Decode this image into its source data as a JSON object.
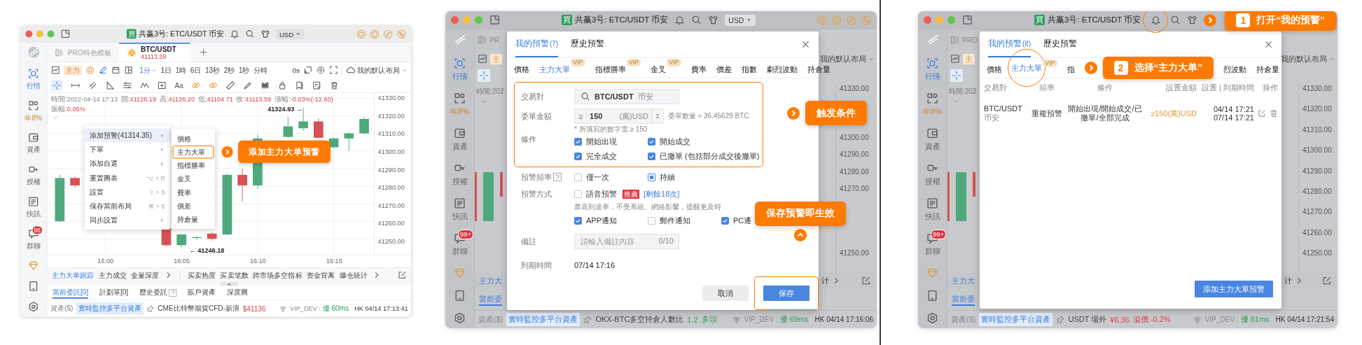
{
  "panels": [
    {
      "kind": "chart",
      "title_bar": {
        "badge": "買",
        "title": "共赢3号: ETC/USDT 币安",
        "bell_circled": false,
        "currency": "USD"
      },
      "sidebar": [
        {
          "kind": "market",
          "label": "行情",
          "selected": true
        },
        {
          "kind": "yield",
          "label": "年8%",
          "selected": false
        },
        {
          "kind": "assets",
          "label": "資產",
          "selected": false
        },
        {
          "kind": "auth",
          "label": "授權",
          "selected": false
        },
        {
          "kind": "news",
          "label": "快訊",
          "selected": false
        },
        {
          "kind": "chat",
          "label": "群聊",
          "selected": false,
          "badge": "96"
        }
      ],
      "tabs": [
        {
          "kind": "template",
          "label": "PRO特色模板",
          "selected": false
        },
        {
          "kind": "symbol",
          "label": "BTC/USDT",
          "price": "41113.59",
          "selected": true
        }
      ],
      "toolbar": {
        "badge": "主力",
        "intervals": [
          {
            "label": "1分",
            "selected": true
          },
          {
            "label": "1日",
            "selected": false
          },
          {
            "label": "1時",
            "selected": false
          },
          {
            "label": "6日",
            "selected": false
          },
          {
            "label": "13秒",
            "selected": false
          },
          {
            "label": "2秒",
            "selected": false
          },
          {
            "label": "1秒",
            "selected": false
          },
          {
            "label": "分時",
            "selected": false
          }
        ],
        "countdown": "0s",
        "layout": "我的默认布局"
      },
      "drawing_tools": {
        "text_tool": "Aa"
      },
      "chart": {
        "info": [
          {
            "kind": "time",
            "label": "時間:",
            "value": "2022-04-14 17:13"
          },
          {
            "kind": "price",
            "label": "開:",
            "value": "41126.19"
          },
          {
            "kind": "price",
            "label": "高:",
            "value": "41126.20"
          },
          {
            "kind": "price",
            "label": "低:",
            "value": "41104.71"
          },
          {
            "kind": "price",
            "label": "收:",
            "value": "41113.59"
          },
          {
            "kind": "price",
            "label": "漲幅:",
            "value": "-0.03%(-12.60)"
          },
          {
            "kind": "price",
            "label": "振幅:",
            "value": "0.05%"
          }
        ],
        "high_marker": "41324.93 →",
        "low_marker": "← 41246.18",
        "chart_data": {
          "type": "candlestick",
          "categories": [
            null,
            null,
            null,
            null,
            "16:00",
            null,
            null,
            null,
            null,
            "16:05",
            null,
            null,
            null,
            null,
            "16:10",
            null,
            null,
            null,
            null,
            "16:15",
            null,
            null
          ],
          "ohlc": [
            null,
            [
              41260.0,
              41286.4,
              41259.3,
              41284.6
            ],
            [
              41284.6,
              41285.4,
              41279.3,
              41280.4
            ],
            null,
            null,
            null,
            null,
            null,
            [
              41256.1,
              41256.1,
              41245.7,
              41246.4
            ],
            [
              41246.4,
              41252.5,
              41245.4,
              41252.5
            ],
            [
              41250.5,
              41251.5,
              41249.5,
              41251.0
            ],
            [
              41253.0,
              41253.5,
              41249.0,
              41250.0
            ],
            [
              41252.5,
              41287.1,
              41252.1,
              41286.4
            ],
            [
              41286.4,
              41290.0,
              41271.1,
              41280.4
            ],
            [
              41280.4,
              41309.3,
              41278.6,
              41307.1
            ],
            null,
            [
              41308.0,
              41319.3,
              41307.5,
              41314.0
            ],
            [
              41312.9,
              41324.6,
              41311.4,
              41316.8
            ],
            [
              41316.8,
              41318.6,
              41307.5,
              41307.5
            ],
            [
              41302.1,
              41307.8,
              41301.4,
              41307.1
            ],
            [
              41307.1,
              41310.7,
              41300.0,
              41310.0
            ],
            [
              41310.0,
              41319.3,
              41309.3,
              41318.2
            ]
          ],
          "grid": true,
          "ylim": [
            41241.1,
            41332.9
          ],
          "yticks": [
            {
              "value": 41330,
              "label": "41330.00"
            },
            {
              "value": 41320,
              "label": "41320.00"
            },
            {
              "value": 41310,
              "label": "41310.00"
            },
            {
              "value": 41300,
              "label": "41300.00"
            },
            {
              "value": 41290,
              "label": "41290.00"
            },
            {
              "value": 41280,
              "label": "41280.00"
            },
            {
              "value": 41270,
              "label": "41270.00"
            },
            {
              "value": 41260,
              "label": "41260.00"
            },
            {
              "value": 41250,
              "label": "41250.00"
            }
          ],
          "ylabel": null
        }
      },
      "context_menu": [
        {
          "label": "添加預警(41314.35)",
          "submenu": true,
          "selected": true
        },
        {
          "label": "下單",
          "submenu": true,
          "selected": false
        },
        {
          "label": "添加自選",
          "submenu": true,
          "selected": false
        },
        {
          "label": "重置圖表",
          "submenu": false,
          "selected": false,
          "shortcut": "⌥ + R"
        },
        {
          "label": "設置",
          "submenu": false,
          "selected": false,
          "shortcut": "⇧ + S"
        },
        {
          "label": "保存當前布局",
          "submenu": false,
          "selected": false,
          "shortcut": "⌘ + S"
        },
        {
          "label": "同步設置",
          "submenu": true,
          "selected": false
        }
      ],
      "submenu": [
        {
          "label": "價格",
          "highlighted": false
        },
        {
          "label": "主力大單",
          "highlighted": true
        },
        {
          "label": "指標勝率",
          "highlighted": false
        },
        {
          "label": "金叉",
          "highlighted": false
        },
        {
          "label": "費率",
          "highlighted": false
        },
        {
          "label": "價差",
          "highlighted": false
        },
        {
          "label": "持倉量",
          "highlighted": false
        }
      ],
      "callout": {
        "kind": "callout_right",
        "text": "添加主力大单预警"
      },
      "indicators": {
        "primary": [
          {
            "label": "主力大单跟踪",
            "selected": true
          },
          {
            "label": "主力成交",
            "selected": false
          },
          {
            "label": "全量深度",
            "selected": false
          }
        ],
        "secondary": [
          "买卖热度",
          "买卖笔数",
          "跨市场多空指标",
          "资金背离",
          "爆仓統计"
        ]
      },
      "bottom_tabs": [
        {
          "label": "當前委託[0]",
          "selected": true
        },
        {
          "label": "計劃單[0]",
          "selected": false
        },
        {
          "label": "歷史委託",
          "selected": false,
          "hint": "?"
        },
        {
          "label": "賬戶資產",
          "selected": false
        },
        {
          "label": "深度圖",
          "selected": false
        }
      ],
      "status_bar": {
        "assets": "資產($)",
        "monitor": "實時監控多平台資產",
        "ticker": [
          {
            "text": "CME比特幣期貨CFD-新浪",
            "color": "#444444"
          },
          {
            "text": "$41136",
            "color": "#d9434a"
          }
        ],
        "server": "VIP_DEV :",
        "latency": "優 60ms",
        "clock": "HK 04/14 17:13:41"
      }
    },
    {
      "kind": "alert_form",
      "title_bar": {
        "badge": "買",
        "title": "共赢3号: ETC/USDT 币安",
        "bell_circled": false,
        "currency": "USD"
      },
      "sidebar": [
        {
          "kind": "market",
          "label": "行情",
          "selected": true
        },
        {
          "kind": "yield",
          "label": "年8%",
          "selected": false
        },
        {
          "kind": "assets",
          "label": "資產",
          "selected": false
        },
        {
          "kind": "auth",
          "label": "授權",
          "selected": false
        },
        {
          "kind": "news",
          "label": "快訊",
          "selected": false
        },
        {
          "kind": "chat",
          "label": "群聊",
          "selected": false,
          "badge": "99+"
        }
      ],
      "left_strip": {
        "tab": "PR",
        "badge": "主",
        "info": "時間:202",
        "indicator": {
          "label": "主力大",
          "selected": true
        },
        "order_tab": {
          "label": "當前委",
          "selected": true
        }
      },
      "right_strip": {
        "layout": "我的默认布局",
        "items": [
          {
            "kind": "tick",
            "label": "41330.00"
          },
          {
            "kind": "callout_right",
            "text": "触发条件"
          },
          {
            "kind": "tick",
            "label": "41300.00"
          },
          {
            "kind": "tick",
            "label": "41290.00"
          },
          {
            "kind": "tick",
            "label": "41280.00"
          },
          {
            "kind": "tick",
            "label": "41270.00"
          },
          {
            "kind": "callout_up",
            "text": "保存预警即生效"
          },
          {
            "kind": "tick",
            "label": "41250.00"
          }
        ],
        "indicator": "计"
      },
      "modal": {
        "tabs": [
          {
            "label": "我的預警",
            "count": "(7)",
            "selected": true
          },
          {
            "label": "歷史預警",
            "selected": false
          }
        ],
        "types": [
          {
            "kind": "tab",
            "label": "價格",
            "selected": false
          },
          {
            "kind": "tab",
            "label": "主力大單",
            "badge": "VIP",
            "selected": true
          },
          {
            "kind": "tab",
            "label": "指標勝率",
            "badge": "VIP",
            "selected": false
          },
          {
            "kind": "tab",
            "label": "金叉",
            "badge": "VIP",
            "selected": false
          },
          {
            "kind": "tab",
            "label": "費率",
            "selected": false
          },
          {
            "kind": "tab",
            "label": "價差",
            "selected": false
          },
          {
            "kind": "tab",
            "label": "指數",
            "selected": false
          },
          {
            "kind": "tab",
            "label": "劇烈波動",
            "selected": false
          },
          {
            "kind": "tab",
            "label": "持倉量",
            "selected": false
          }
        ],
        "form": {
          "highlighted": true,
          "pair": {
            "label": "交易對",
            "symbol": "BTC/USDT",
            "exchange": "币安"
          },
          "amount": {
            "label": "委單金額",
            "operator": "≥",
            "value": "150",
            "unit": "(萬)USD",
            "estimate": "委單數量 ≈ 36.45629 BTC",
            "hint": "* 所填寫的數字需 ≥ 150"
          },
          "conditions": {
            "label": "條件",
            "options": [
              {
                "label": "開始出現",
                "checked": true
              },
              {
                "label": "開始成交",
                "checked": true
              },
              {
                "label": "完全成交",
                "checked": true
              },
              {
                "label": "已撤單 (包括部分成交後撤單)",
                "checked": true
              }
            ]
          }
        },
        "frequency": {
          "label": "預警頻率",
          "hint": "?",
          "options": [
            {
              "label": "僅一次",
              "selected": false
            },
            {
              "label": "持續",
              "selected": true
            }
          ]
        },
        "method": {
          "label": "預警方式",
          "voice": {
            "label": "語音預警",
            "checked": false,
            "tag": "推薦",
            "quota": "[剩餘18次]",
            "note": "最高到達率，不受系統、網絡影響，提醒更及時"
          },
          "channels": [
            {
              "label": "APP通知",
              "checked": true
            },
            {
              "label": "郵件通知",
              "checked": false
            },
            {
              "label": "PC通",
              "checked": true
            }
          ]
        },
        "remark": {
          "label": "備註",
          "placeholder": "請輸入備註內容",
          "counter": "0/10"
        },
        "expiry": {
          "label": "到期時間",
          "value": "07/14 17:16"
        },
        "buttons": [
          {
            "label": "取消",
            "kind": "secondary",
            "highlighted": false
          },
          {
            "label": "保存",
            "kind": "primary",
            "highlighted": true
          }
        ]
      },
      "status_bar": {
        "assets": "資產($)",
        "monitor": "實時監控多平台資產",
        "ticker": [
          {
            "text": "OKX-BTC多空持倉人數比",
            "color": "#444444"
          },
          {
            "text": "1.2",
            "color": "#2e9e5b"
          },
          {
            "text": "多頭",
            "color": "#2e9e5b"
          }
        ],
        "server": "VIP_DEV :",
        "latency": "優 69ms",
        "clock": "HK 04/14 17:16:06"
      }
    },
    {
      "kind": "alert_list",
      "title_bar": {
        "badge": "買",
        "title": "共赢3号: ETC/USDT 币安",
        "bell_circled": true,
        "callout": {
          "kind": "callout_right",
          "text": "打开“我的预警”",
          "step": "1"
        }
      },
      "sidebar": [
        {
          "kind": "market",
          "label": "行情",
          "selected": true
        },
        {
          "kind": "yield",
          "label": "年8%",
          "selected": false
        },
        {
          "kind": "assets",
          "label": "資產",
          "selected": false
        },
        {
          "kind": "auth",
          "label": "授權",
          "selected": false
        },
        {
          "kind": "news",
          "label": "快訊",
          "selected": false
        },
        {
          "kind": "chat",
          "label": "群聊",
          "selected": false,
          "badge": "99+"
        }
      ],
      "left_strip": {
        "tab": "PRO",
        "badge": "主",
        "info": "時間:202",
        "indicator": {
          "label": "主力大",
          "selected": true
        },
        "order_tab": {
          "label": "當前委",
          "selected": true
        }
      },
      "right_strip": {
        "layout": "我的默认布局",
        "items": [
          {
            "kind": "tick",
            "label": "41330.00"
          },
          {
            "kind": "tick",
            "label": "41320.00"
          },
          {
            "kind": "tick",
            "label": "41310.00"
          },
          {
            "kind": "tick",
            "label": "41300.00"
          },
          {
            "kind": "tick",
            "label": "41290.00"
          },
          {
            "kind": "tick",
            "label": "41280.00"
          },
          {
            "kind": "tick",
            "label": "41270.00"
          },
          {
            "kind": "tick",
            "label": "41260.00"
          },
          {
            "kind": "tick",
            "label": "41250.00"
          }
        ],
        "indicator": "计"
      },
      "modal": {
        "tabs": [
          {
            "label": "我的預警",
            "count": "(8)",
            "selected": true
          },
          {
            "label": "歷史預警",
            "selected": false
          }
        ],
        "types": [
          {
            "kind": "tab",
            "label": "價格",
            "selected": false,
            "circled": false
          },
          {
            "kind": "tab",
            "label": "主力大單",
            "badge": "VIP",
            "selected": true,
            "circled": true
          },
          {
            "kind": "tab",
            "label": "指",
            "selected": false,
            "circled": false
          },
          {
            "kind": "callout_right",
            "text": "选择“主力大单”",
            "step": "2"
          },
          {
            "kind": "tab",
            "label": "烈波動",
            "selected": false,
            "circled": false
          },
          {
            "kind": "tab",
            "label": "持倉量",
            "selected": false,
            "circled": false
          }
        ],
        "table": {
          "columns": [
            "交易對",
            "頻率",
            "條件",
            "設置金額",
            "設置 | 到期時間",
            "操作"
          ],
          "rows": [
            {
              "pair": "BTC/USDT",
              "exchange": "币安",
              "frequency": "重複預警",
              "conditions": "開始出現/開始成交/已撤單/全部完成",
              "amount": "≥150(萬)USD",
              "created": "04/14 17:21",
              "expires": "07/14 17:21"
            }
          ]
        },
        "buttons": [
          {
            "label": "添加主力大單預警",
            "kind": "primary",
            "highlighted": false
          }
        ]
      },
      "status_bar": {
        "assets": "資產($)",
        "monitor": "實時監控多平台資產",
        "ticker": [
          {
            "text": "USDT 場外",
            "color": "#444444"
          },
          {
            "text": "¥6.36",
            "color": "#d9434a"
          },
          {
            "text": "溢價 -0.2%",
            "color": "#d9434a"
          }
        ],
        "server": "VIP_DEV :",
        "latency": "優 81ms",
        "clock": "HK 04/14 17:21:54"
      }
    }
  ]
}
